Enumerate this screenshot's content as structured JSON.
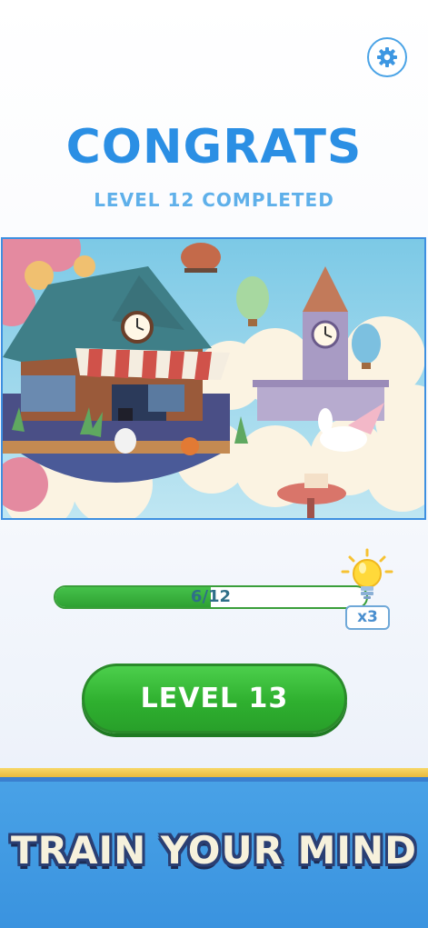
{
  "header": {
    "settings_icon": "gear-icon",
    "title": "CONGRATS",
    "subtitle": "LEVEL 12 COMPLETED"
  },
  "artwork": {
    "description_icon": "completed-puzzle-image"
  },
  "progress": {
    "label": "6/12",
    "fraction": 0.5
  },
  "hints": {
    "icon": "lightbulb-icon",
    "count_label": "x3"
  },
  "actions": {
    "next_level_label": "LEVEL 13"
  },
  "banner": {
    "text": "TRAIN YOUR MIND"
  },
  "colors": {
    "title": "#2b8fe4",
    "subtitle": "#5fb0ea",
    "button_green": "#2fb02f",
    "banner_blue": "#3a93df",
    "banner_gold": "#e9b93c"
  }
}
